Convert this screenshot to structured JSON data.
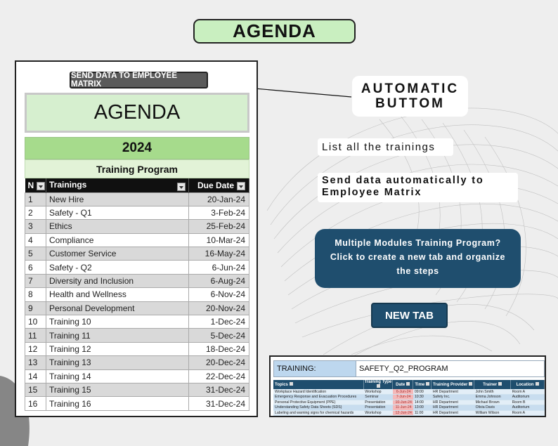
{
  "title": "AGENDA",
  "sheet": {
    "send_button": "SEND DATA TO EMPLOYEE MATRIX",
    "agenda_heading": "AGENDA",
    "year": "2024",
    "program_title": "Training Program",
    "columns": {
      "n": "N",
      "trainings": "Trainings",
      "due_date": "Due Date"
    },
    "rows": [
      {
        "n": "1",
        "training": "New Hire",
        "date": "20-Jan-24"
      },
      {
        "n": "2",
        "training": "Safety - Q1",
        "date": "3-Feb-24"
      },
      {
        "n": "3",
        "training": "Ethics",
        "date": "25-Feb-24"
      },
      {
        "n": "4",
        "training": "Compliance",
        "date": "10-Mar-24"
      },
      {
        "n": "5",
        "training": "Customer Service",
        "date": "16-May-24"
      },
      {
        "n": "6",
        "training": "Safety - Q2",
        "date": "6-Jun-24"
      },
      {
        "n": "7",
        "training": "Diversity and Inclusion",
        "date": "6-Aug-24"
      },
      {
        "n": "8",
        "training": "Health and Wellness",
        "date": "6-Nov-24"
      },
      {
        "n": "9",
        "training": "Personal Development",
        "date": "20-Nov-24"
      },
      {
        "n": "10",
        "training": "Training 10",
        "date": "1-Dec-24"
      },
      {
        "n": "11",
        "training": "Training 11",
        "date": "5-Dec-24"
      },
      {
        "n": "12",
        "training": "Training 12",
        "date": "18-Dec-24"
      },
      {
        "n": "13",
        "training": "Training 13",
        "date": "20-Dec-24"
      },
      {
        "n": "14",
        "training": "Training 14",
        "date": "22-Dec-24"
      },
      {
        "n": "15",
        "training": "Training 15",
        "date": "31-Dec-24"
      },
      {
        "n": "16",
        "training": "Training 16",
        "date": "31-Dec-24"
      }
    ]
  },
  "callouts": {
    "automatic_line1": "AUTOMATIC",
    "automatic_line2": "BUTTOM",
    "list_all": "List all the trainings",
    "send_data": "Send data automatically to Employee Matrix",
    "modules_line1": "Multiple Modules Training Program?",
    "modules_line2": "Click to create a new tab and organize",
    "modules_line3": "the steps",
    "new_tab": "NEW TAB"
  },
  "mini_sheet": {
    "training_label": "TRAINING:",
    "training_value": "SAFETY_Q2_PROGRAM",
    "columns": [
      "Topics",
      "Training Type",
      "Date",
      "Time",
      "Training Provider",
      "Trainer",
      "Location"
    ],
    "rows": [
      [
        "Workplace Hazard Identification",
        "Workshop",
        "6-Jun-24",
        "09:00",
        "HR Department",
        "John Smith",
        "Room A"
      ],
      [
        "Emergency Response and Evacuation Procedures",
        "Seminar",
        "7-Jun-24",
        "10:30",
        "Safety Inc.",
        "Emma Johnson",
        "Auditorium"
      ],
      [
        "Personal Protective Equipment (PPE)",
        "Presentation",
        "10-Jun-24",
        "14:00",
        "HR Department",
        "Michael Brown",
        "Room B"
      ],
      [
        "Understanding Safety Data Sheets (SDS)",
        "Presentation",
        "11-Jun-24",
        "13:00",
        "HR Department",
        "Olivia Davis",
        "Auditorium"
      ],
      [
        "Labeling and warning signs for chemical hazards",
        "Workshop",
        "12-Jun-24",
        "11:00",
        "HR Department",
        "William Wilson",
        "Room A"
      ]
    ]
  },
  "colors": {
    "title_green": "#c9efc0",
    "year_green": "#a6db8c",
    "navy": "#1f4e6e",
    "date_highlight": "#f4b9b9"
  }
}
